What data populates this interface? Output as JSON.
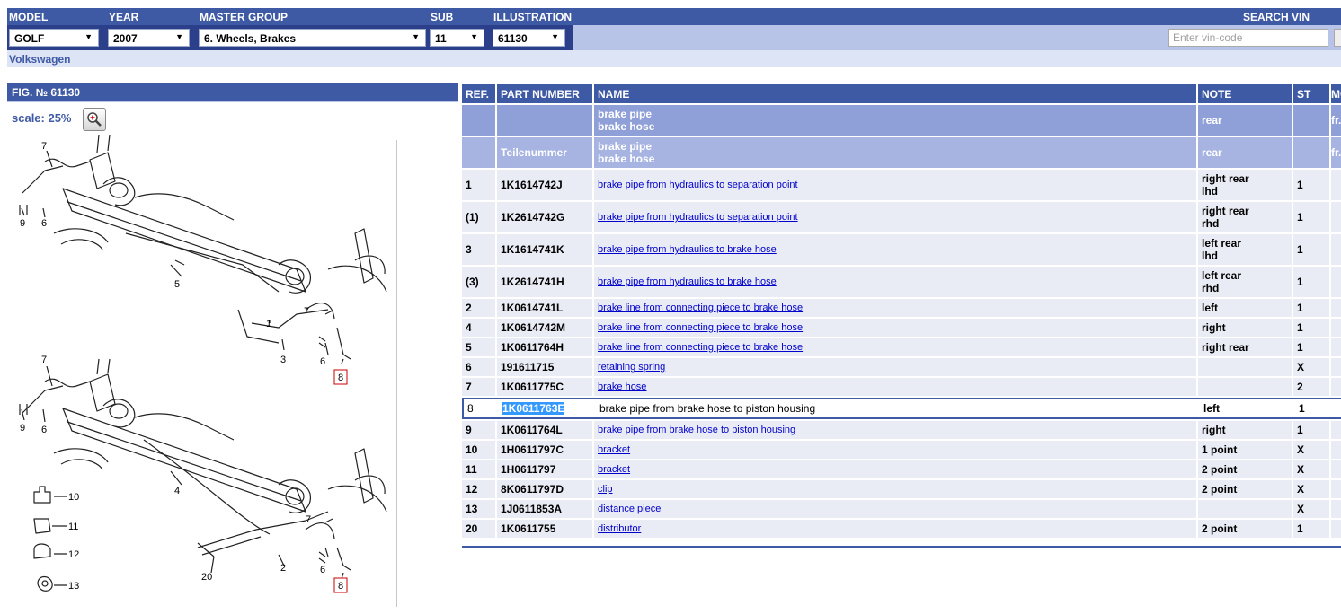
{
  "topbar": {
    "labels": {
      "model": "MODEL",
      "year": "YEAR",
      "master_group": "MASTER GROUP",
      "sub": "SUB",
      "illustration": "ILLUSTRATION",
      "search_vin": "SEARCH VIN"
    },
    "selects": {
      "model": "GOLF",
      "year": "2007",
      "master_group": "6. Wheels, Brakes",
      "sub": "11",
      "illustration": "61130"
    },
    "vin_placeholder": "Enter vin-code",
    "brand": "Volkswagen"
  },
  "figure": {
    "title": "FIG. № 61130",
    "scale": "scale: 25%",
    "callouts": {
      "c7": "7",
      "c9": "9",
      "c6": "6",
      "c5": "5",
      "c1": "1",
      "c3": "3",
      "c8": "8",
      "c4": "4",
      "c2": "2",
      "c20": "20",
      "c10": "10",
      "c11": "11",
      "c12": "12",
      "c13": "13"
    }
  },
  "table": {
    "headers": {
      "ref": "REF.",
      "part_number": "PART NUMBER",
      "name": "NAME",
      "note": "NOTE",
      "st": "ST",
      "mo": "MO"
    },
    "groups": [
      {
        "part_number": "",
        "name_line1": "brake pipe",
        "name_line2": "brake hose",
        "note": "rear",
        "mo": "fr."
      },
      {
        "part_number": "Teilenummer",
        "name_line1": "brake pipe",
        "name_line2": "brake hose",
        "note": "rear",
        "mo": "fr."
      }
    ],
    "rows": [
      {
        "ref": "1",
        "part_number": "1K1614742J",
        "name": "brake pipe from hydraulics to separation point",
        "note_line1": "right rear",
        "note_line2": "lhd",
        "st": "1"
      },
      {
        "ref": "(1)",
        "part_number": "1K2614742G",
        "name": "brake pipe from hydraulics to separation point",
        "note_line1": "right rear",
        "note_line2": "rhd",
        "st": "1"
      },
      {
        "ref": "3",
        "part_number": "1K1614741K",
        "name": "brake pipe from hydraulics to brake hose",
        "note_line1": "left rear",
        "note_line2": "lhd",
        "st": "1"
      },
      {
        "ref": "(3)",
        "part_number": "1K2614741H",
        "name": "brake pipe from hydraulics to brake hose",
        "note_line1": "left rear",
        "note_line2": "rhd",
        "st": "1"
      },
      {
        "ref": "2",
        "part_number": "1K0614741L",
        "name": "brake line from connecting piece to brake hose",
        "note_line1": "left",
        "st": "1"
      },
      {
        "ref": "4",
        "part_number": "1K0614742M",
        "name": "brake line from connecting piece to brake hose",
        "note_line1": "right",
        "st": "1"
      },
      {
        "ref": "5",
        "part_number": "1K0611764H",
        "name": "brake line from connecting piece to brake hose",
        "note_line1": "right rear",
        "st": "1"
      },
      {
        "ref": "6",
        "part_number": "191611715",
        "name": "retaining spring",
        "note_line1": "",
        "st": "X"
      },
      {
        "ref": "7",
        "part_number": "1K0611775C",
        "name": "brake hose",
        "note_line1": "",
        "st": "2"
      },
      {
        "ref": "8",
        "part_number": "1K0611763E",
        "name": "brake pipe from brake hose to piston housing",
        "note_line1": "left",
        "st": "1"
      },
      {
        "ref": "9",
        "part_number": "1K0611764L",
        "name": "brake pipe from brake hose to piston housing",
        "note_line1": "right",
        "st": "1"
      },
      {
        "ref": "10",
        "part_number": "1H0611797C",
        "name": "bracket",
        "note_line1": "1 point",
        "st": "X"
      },
      {
        "ref": "11",
        "part_number": "1H0611797",
        "name": "bracket",
        "note_line1": "2 point",
        "st": "X"
      },
      {
        "ref": "12",
        "part_number": "8K0611797D",
        "name": "clip",
        "note_line1": "2 point",
        "st": "X"
      },
      {
        "ref": "13",
        "part_number": "1J0611853A",
        "name": "distance piece",
        "note_line1": "",
        "st": "X"
      },
      {
        "ref": "20",
        "part_number": "1K0611755",
        "name": "distributor",
        "note_line1": "2 point",
        "st": "1"
      }
    ]
  },
  "colors": {
    "header_blue": "#3f5aa4",
    "dark_navy": "#2c3f8a",
    "light_bar": "#b7c4e8",
    "group_row": "#8fa0d8",
    "row_bg": "#e9ecf4",
    "link": "#0000cc",
    "selection": "#3399ff",
    "callout_box": "#cc0000"
  }
}
